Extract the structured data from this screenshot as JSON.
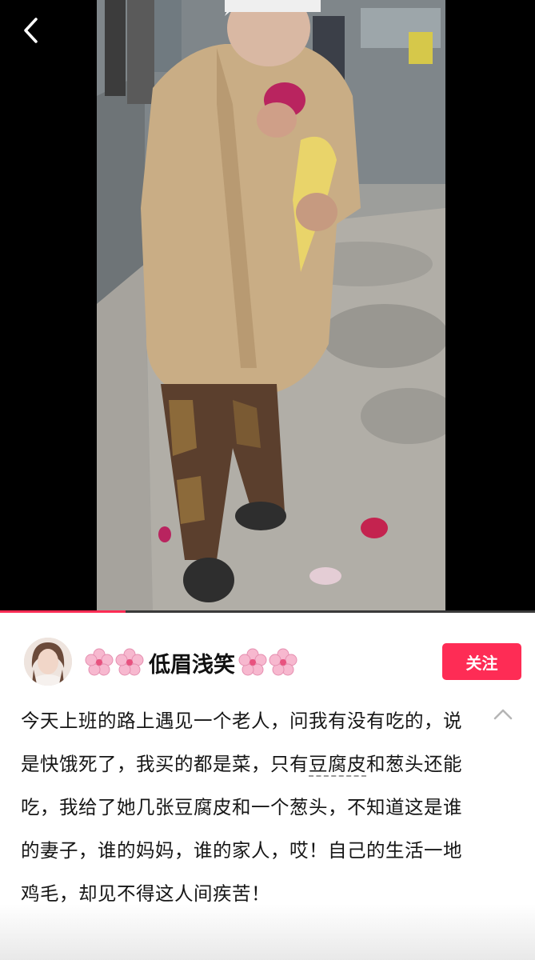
{
  "nav": {
    "back_icon": "chevron-left-icon"
  },
  "video": {
    "progress_fraction": 0.235
  },
  "author": {
    "name": "低眉浅笑",
    "avatar_icon": "user-avatar",
    "decoration_icon": "cherry-blossom-icon",
    "follow_label": "关注",
    "accent_color": "#fe2c55"
  },
  "caption": {
    "text_before": "今天上班的路上遇见一个老人，问我有没有吃的，说是快饿死了，我买的都是菜，只有",
    "link_text": "豆腐皮",
    "text_after": "和葱头还能吃，我给了她几张豆腐皮和一个葱头，不知道这是谁的妻子，谁的妈妈，谁的家人，哎！自己的生活一地鸡毛，却见不得这人间疾苦！",
    "collapse_icon": "chevron-up-icon"
  }
}
